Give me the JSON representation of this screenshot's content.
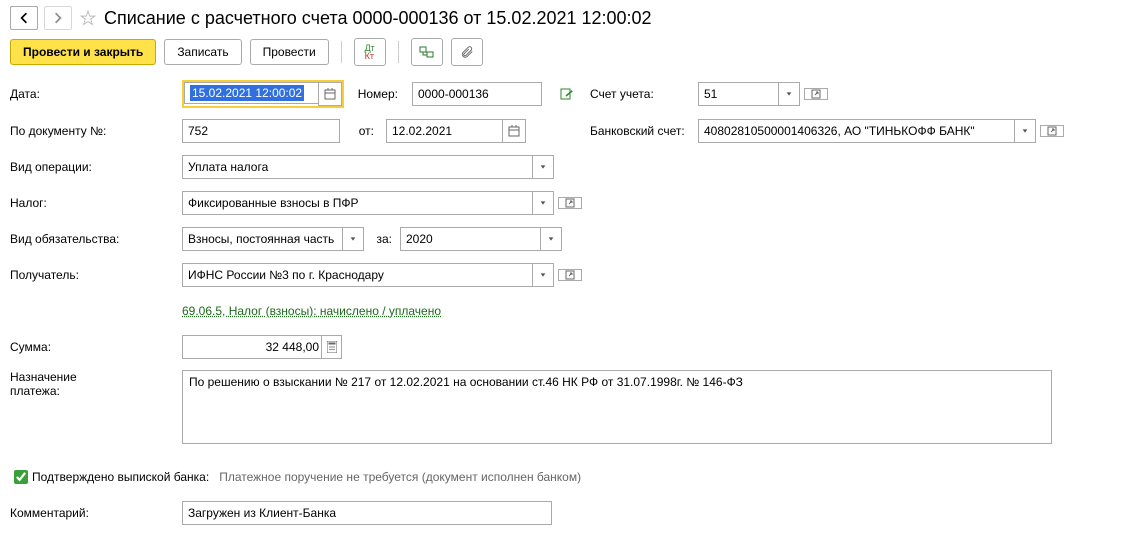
{
  "title": "Списание с расчетного счета 0000-000136 от 15.02.2021 12:00:02",
  "toolbar": {
    "post_close": "Провести и закрыть",
    "save": "Записать",
    "post": "Провести"
  },
  "labels": {
    "date": "Дата:",
    "number": "Номер:",
    "account": "Счет учета:",
    "by_doc": "По документу №:",
    "from": "от:",
    "bank_acc": "Банковский счет:",
    "op_type": "Вид операции:",
    "tax": "Налог:",
    "liability": "Вид обязательства:",
    "for": "за:",
    "recipient": "Получатель:",
    "sum": "Сумма:",
    "purpose_l1": "Назначение",
    "purpose_l2": "платежа:",
    "confirmed": "Подтверждено выпиской банка:",
    "confirmed_note": "Платежное поручение не требуется (документ исполнен банком)",
    "comment": "Комментарий:"
  },
  "values": {
    "date": "15.02.2021 12:00:02",
    "number": "0000-000136",
    "account": "51",
    "by_doc": "752",
    "from_date": "12.02.2021",
    "bank_acc": "40802810500001406326, АО \"ТИНЬКОФФ БАНК\"",
    "op_type": "Уплата налога",
    "tax": "Фиксированные взносы в ПФР",
    "liability": "Взносы, постоянная часть",
    "year": "2020",
    "recipient": "ИФНС России №3 по г. Краснодару",
    "link": "69.06.5, Налог (взносы): начислено / уплачено",
    "sum": "32 448,00",
    "purpose": "По решению о взыскании № 217 от 12.02.2021 на основании ст.46 НК РФ от 31.07.1998г. № 146-ФЗ",
    "comment": "Загружен из Клиент-Банка"
  }
}
